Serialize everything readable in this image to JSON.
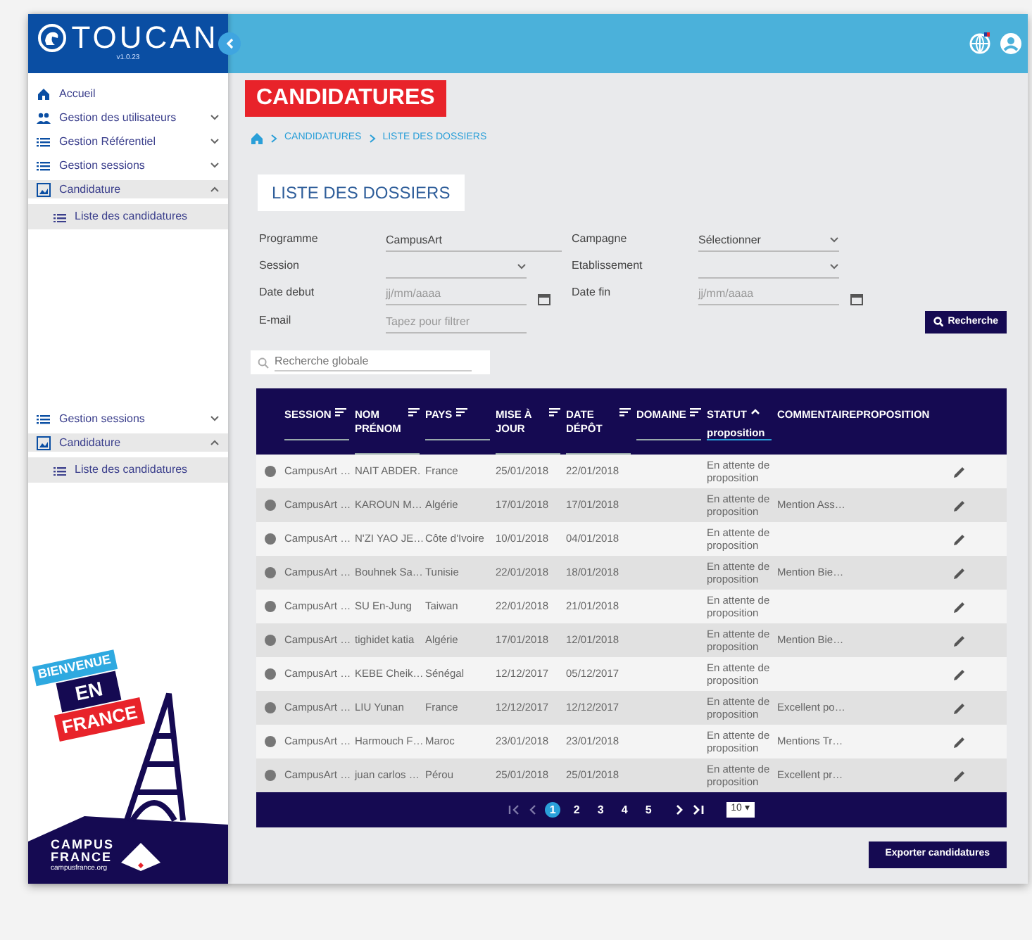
{
  "sidebar": {
    "logo": "TOUCAN",
    "version": "v1.0.23",
    "menu": [
      {
        "label": "Accueil",
        "kind": "link"
      },
      {
        "label": "Gestion des utilisateurs",
        "kind": "group",
        "expanded": false
      },
      {
        "label": "Gestion Référentiel",
        "kind": "group",
        "expanded": false
      },
      {
        "label": "Gestion sessions",
        "kind": "group",
        "expanded": false
      },
      {
        "label": "Candidature",
        "kind": "group",
        "expanded": true,
        "children": [
          {
            "label": "Liste des candidatures"
          }
        ]
      }
    ],
    "menu_repeat": [
      {
        "label": "Gestion sessions",
        "kind": "group",
        "expanded": false
      },
      {
        "label": "Candidature",
        "kind": "group",
        "expanded": true,
        "children": [
          {
            "label": "Liste des candidatures"
          }
        ]
      }
    ],
    "promo": {
      "line_1": "BIENVENUE",
      "line_2": "EN",
      "line_3": "FRANCE"
    },
    "brand": {
      "line_1": "CAMPUS",
      "line_2": "FRANCE",
      "url": "campusfrance.org"
    }
  },
  "page_title": "CANDIDATURES",
  "breadcrumb": [
    "CANDIDATURES",
    "LISTE DES DOSSIERS"
  ],
  "section_title": "LISTE DES DOSSIERS",
  "filters": [
    {
      "label": "Programme",
      "kind": "text",
      "value": "CampusArt"
    },
    {
      "label": "Campagne",
      "kind": "select",
      "value": "Sélectionner"
    },
    {
      "label": "Session",
      "kind": "select"
    },
    {
      "label": "Etablissement",
      "kind": "select"
    },
    {
      "label": "Date debut",
      "kind": "date",
      "placeholder": "jj/mm/aaaa"
    },
    {
      "label": "Date fin",
      "kind": "date",
      "placeholder": "jj/mm/aaaa"
    },
    {
      "label": "E-mail",
      "kind": "text",
      "placeholder": "Tapez pour filtrer"
    }
  ],
  "search_button": "Recherche",
  "global_search": {
    "placeholder": "Recherche globale"
  },
  "table": {
    "columns": [
      {
        "label": "SESSION",
        "sortable": true,
        "sorted": false,
        "filterable": true
      },
      {
        "label": "NOM PRÉNOM",
        "sortable": true,
        "sorted": false,
        "filterable": true
      },
      {
        "label": "PAYS",
        "sortable": true,
        "sorted": false,
        "filterable": true
      },
      {
        "label": "MISE À JOUR",
        "sortable": true,
        "sorted": false,
        "filterable": true
      },
      {
        "label": "DATE DÉPÔT",
        "sortable": true,
        "sorted": false,
        "filterable": true
      },
      {
        "label": "DOMAINE",
        "sortable": true,
        "sorted": false,
        "filterable": true
      },
      {
        "label": "STATUT",
        "sortable": true,
        "sorted": true,
        "filterable": true,
        "filter": "proposition"
      },
      {
        "label": "COMMENTAIREPROPOSITION",
        "sortable": false,
        "filterable": false
      }
    ],
    "rows": [
      [
        "CampusArt …",
        "NAIT ABDER.",
        "France",
        "25/01/2018",
        "22/01/2018",
        "",
        "En attente de proposition",
        ""
      ],
      [
        "CampusArt …",
        "KAROUN M…",
        "Algérie",
        "17/01/2018",
        "17/01/2018",
        "",
        "En attente de proposition",
        "Mention Ass…"
      ],
      [
        "CampusArt …",
        "N'ZI YAO JE…",
        "Côte d'Ivoire",
        "10/01/2018",
        "04/01/2018",
        "",
        "En attente de proposition",
        ""
      ],
      [
        "CampusArt …",
        "Bouhnek Sa…",
        "Tunisie",
        "22/01/2018",
        "18/01/2018",
        "",
        "En attente de proposition",
        "Mention Bie…"
      ],
      [
        "CampusArt …",
        "SU En-Jung",
        "Taiwan",
        "22/01/2018",
        "21/01/2018",
        "",
        "En attente de proposition",
        ""
      ],
      [
        "CampusArt …",
        "tighidet katia",
        "Algérie",
        "17/01/2018",
        "12/01/2018",
        "",
        "En attente de proposition",
        "Mention Bie…"
      ],
      [
        "CampusArt …",
        "KEBE Cheik…",
        "Sénégal",
        "12/12/2017",
        "05/12/2017",
        "",
        "En attente de proposition",
        ""
      ],
      [
        "CampusArt …",
        "LIU Yunan",
        "France",
        "12/12/2017",
        "12/12/2017",
        "",
        "En attente de proposition",
        "Excellent po…"
      ],
      [
        "CampusArt …",
        "Harmouch F…",
        "Maroc",
        "23/01/2018",
        "23/01/2018",
        "",
        "En attente de proposition",
        "Mentions Tr…"
      ],
      [
        "CampusArt …",
        "juan carlos …",
        "Pérou",
        "25/01/2018",
        "25/01/2018",
        "",
        "En attente de proposition",
        "Excellent pr…"
      ]
    ]
  },
  "pagination": {
    "pages": [
      {
        "label": "1",
        "selected": true
      },
      {
        "label": "2",
        "selected": false
      },
      {
        "label": "3",
        "selected": false
      },
      {
        "label": "4",
        "selected": false
      },
      {
        "label": "5",
        "selected": false
      }
    ],
    "page_size": "10 ▾"
  },
  "export_button": "Exporter candidatures"
}
